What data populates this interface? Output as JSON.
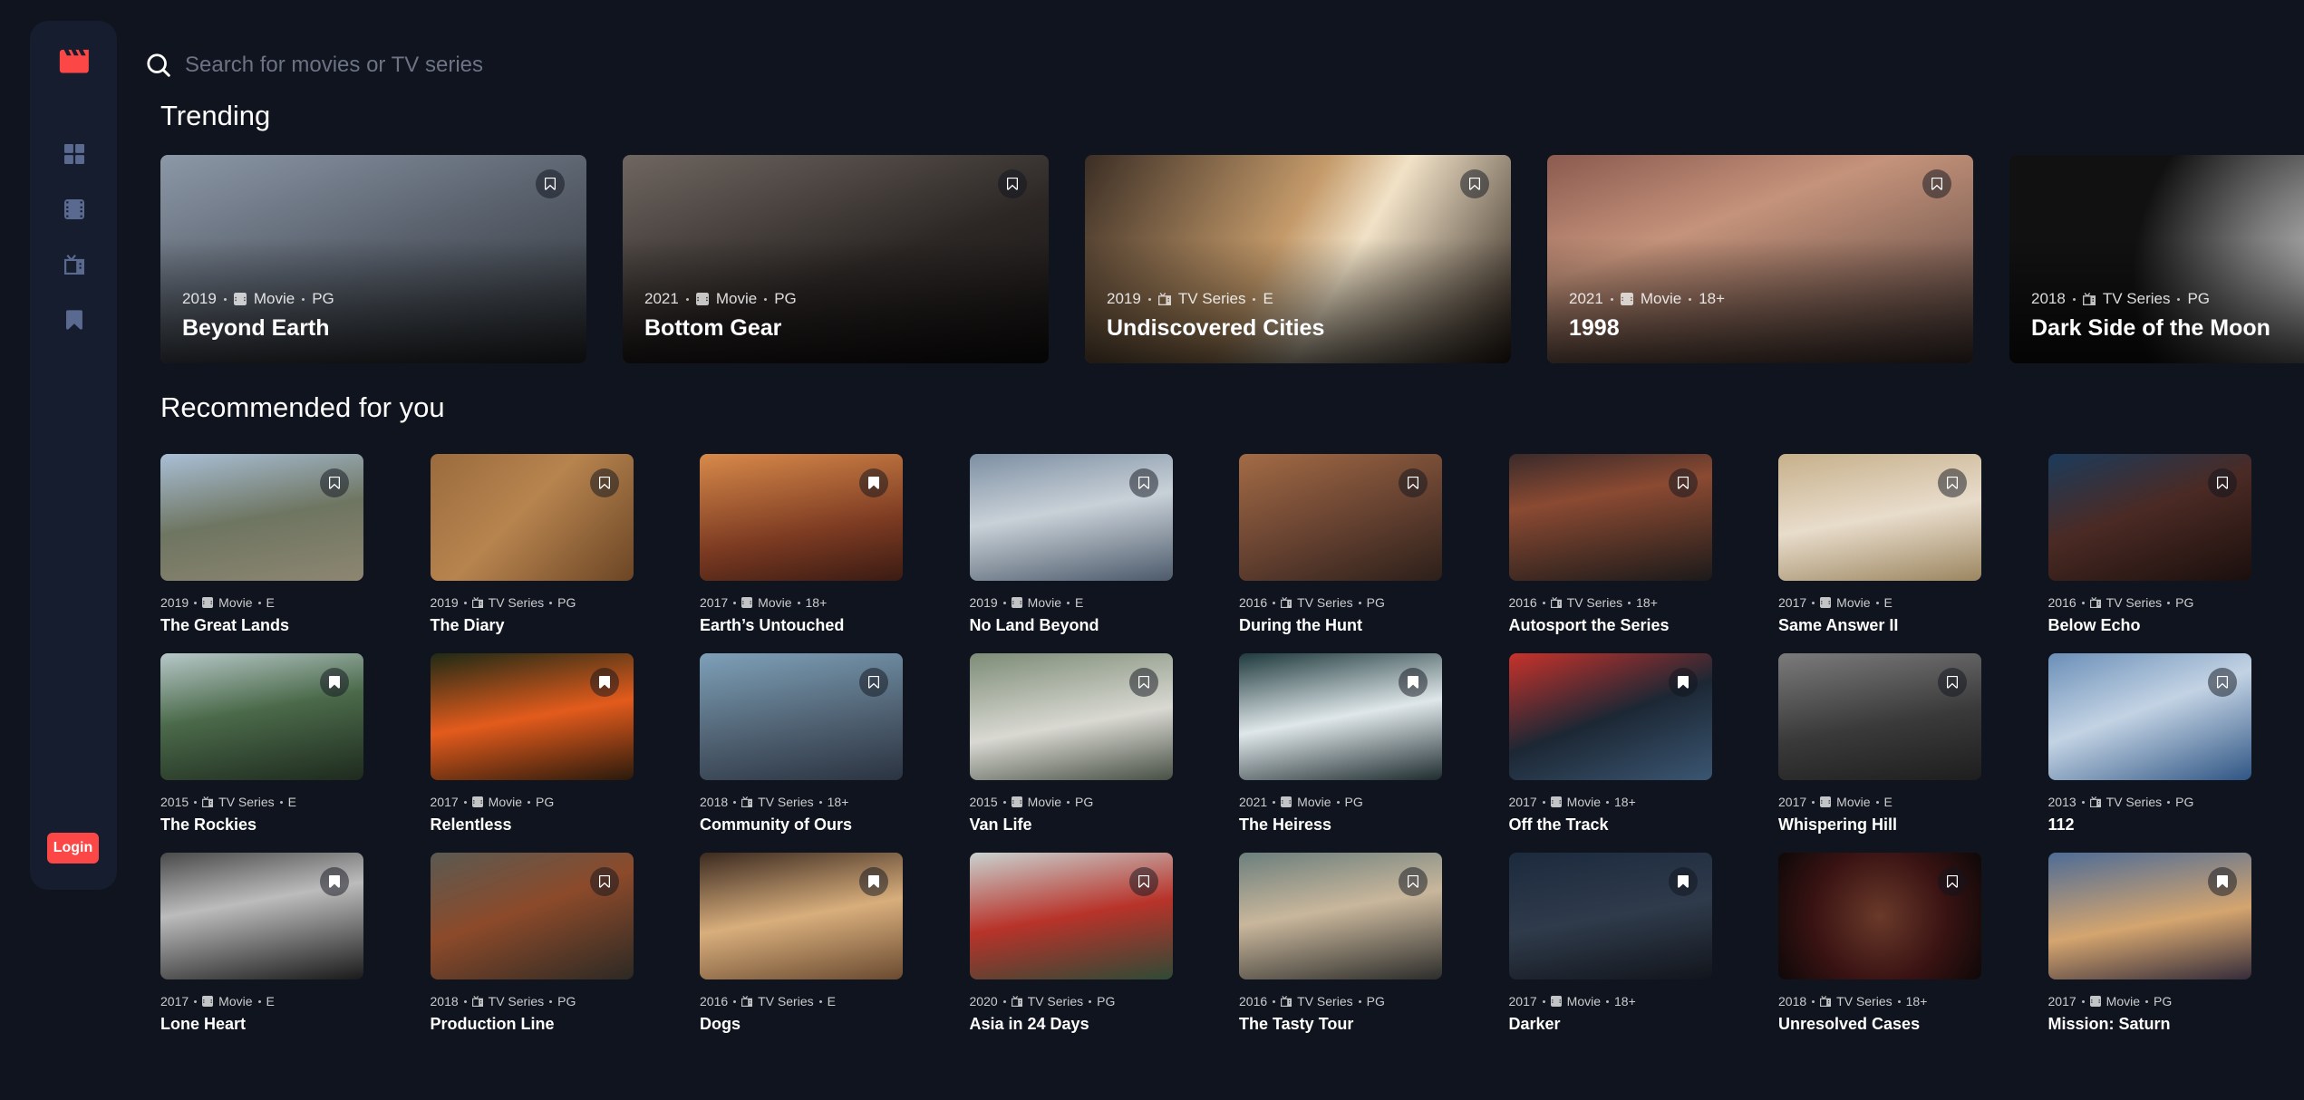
{
  "nav": {
    "logo": "movie-logo-icon",
    "items": [
      "home-icon",
      "movies-icon",
      "tv-series-icon",
      "bookmark-icon"
    ],
    "login_label": "Login"
  },
  "search": {
    "placeholder": "Search for movies or TV series",
    "value": ""
  },
  "trending": {
    "title": "Trending",
    "items": [
      {
        "year": "2019",
        "category": "Movie",
        "rating": "PG",
        "title": "Beyond Earth",
        "bookmarked": false
      },
      {
        "year": "2021",
        "category": "Movie",
        "rating": "PG",
        "title": "Bottom Gear",
        "bookmarked": false
      },
      {
        "year": "2019",
        "category": "TV Series",
        "rating": "E",
        "title": "Undiscovered Cities",
        "bookmarked": false
      },
      {
        "year": "2021",
        "category": "Movie",
        "rating": "18+",
        "title": "1998",
        "bookmarked": false
      },
      {
        "year": "2018",
        "category": "TV Series",
        "rating": "PG",
        "title": "Dark Side of the Moon",
        "bookmarked": false
      }
    ]
  },
  "recommended": {
    "title": "Recommended for you",
    "items": [
      {
        "year": "2019",
        "category": "Movie",
        "rating": "E",
        "title": "The Great Lands",
        "bookmarked": false
      },
      {
        "year": "2019",
        "category": "TV Series",
        "rating": "PG",
        "title": "The Diary",
        "bookmarked": false
      },
      {
        "year": "2017",
        "category": "Movie",
        "rating": "18+",
        "title": "Earth’s Untouched",
        "bookmarked": true
      },
      {
        "year": "2019",
        "category": "Movie",
        "rating": "E",
        "title": "No Land Beyond",
        "bookmarked": false
      },
      {
        "year": "2016",
        "category": "TV Series",
        "rating": "PG",
        "title": "During the Hunt",
        "bookmarked": false
      },
      {
        "year": "2016",
        "category": "TV Series",
        "rating": "18+",
        "title": "Autosport the Series",
        "bookmarked": false
      },
      {
        "year": "2017",
        "category": "Movie",
        "rating": "E",
        "title": "Same Answer II",
        "bookmarked": false
      },
      {
        "year": "2016",
        "category": "TV Series",
        "rating": "PG",
        "title": "Below Echo",
        "bookmarked": false
      },
      {
        "year": "2015",
        "category": "TV Series",
        "rating": "E",
        "title": "The Rockies",
        "bookmarked": true
      },
      {
        "year": "2017",
        "category": "Movie",
        "rating": "PG",
        "title": "Relentless",
        "bookmarked": true
      },
      {
        "year": "2018",
        "category": "TV Series",
        "rating": "18+",
        "title": "Community of Ours",
        "bookmarked": false
      },
      {
        "year": "2015",
        "category": "Movie",
        "rating": "PG",
        "title": "Van Life",
        "bookmarked": false
      },
      {
        "year": "2021",
        "category": "Movie",
        "rating": "PG",
        "title": "The Heiress",
        "bookmarked": true
      },
      {
        "year": "2017",
        "category": "Movie",
        "rating": "18+",
        "title": "Off the Track",
        "bookmarked": true
      },
      {
        "year": "2017",
        "category": "Movie",
        "rating": "E",
        "title": "Whispering Hill",
        "bookmarked": false
      },
      {
        "year": "2013",
        "category": "TV Series",
        "rating": "PG",
        "title": "112",
        "bookmarked": false
      },
      {
        "year": "2017",
        "category": "Movie",
        "rating": "E",
        "title": "Lone Heart",
        "bookmarked": true
      },
      {
        "year": "2018",
        "category": "TV Series",
        "rating": "PG",
        "title": "Production Line",
        "bookmarked": false
      },
      {
        "year": "2016",
        "category": "TV Series",
        "rating": "E",
        "title": "Dogs",
        "bookmarked": true
      },
      {
        "year": "2020",
        "category": "TV Series",
        "rating": "PG",
        "title": "Asia in 24 Days",
        "bookmarked": false
      },
      {
        "year": "2016",
        "category": "TV Series",
        "rating": "PG",
        "title": "The Tasty Tour",
        "bookmarked": false
      },
      {
        "year": "2017",
        "category": "Movie",
        "rating": "18+",
        "title": "Darker",
        "bookmarked": true
      },
      {
        "year": "2018",
        "category": "TV Series",
        "rating": "18+",
        "title": "Unresolved Cases",
        "bookmarked": false
      },
      {
        "year": "2017",
        "category": "Movie",
        "rating": "PG",
        "title": "Mission: Saturn",
        "bookmarked": true
      }
    ]
  },
  "colors": {
    "background": "#10141E",
    "sidebar": "#161D2F",
    "accent": "#FC4747",
    "muted_text": "#5A698F",
    "nav_icon": "#5A698F"
  }
}
